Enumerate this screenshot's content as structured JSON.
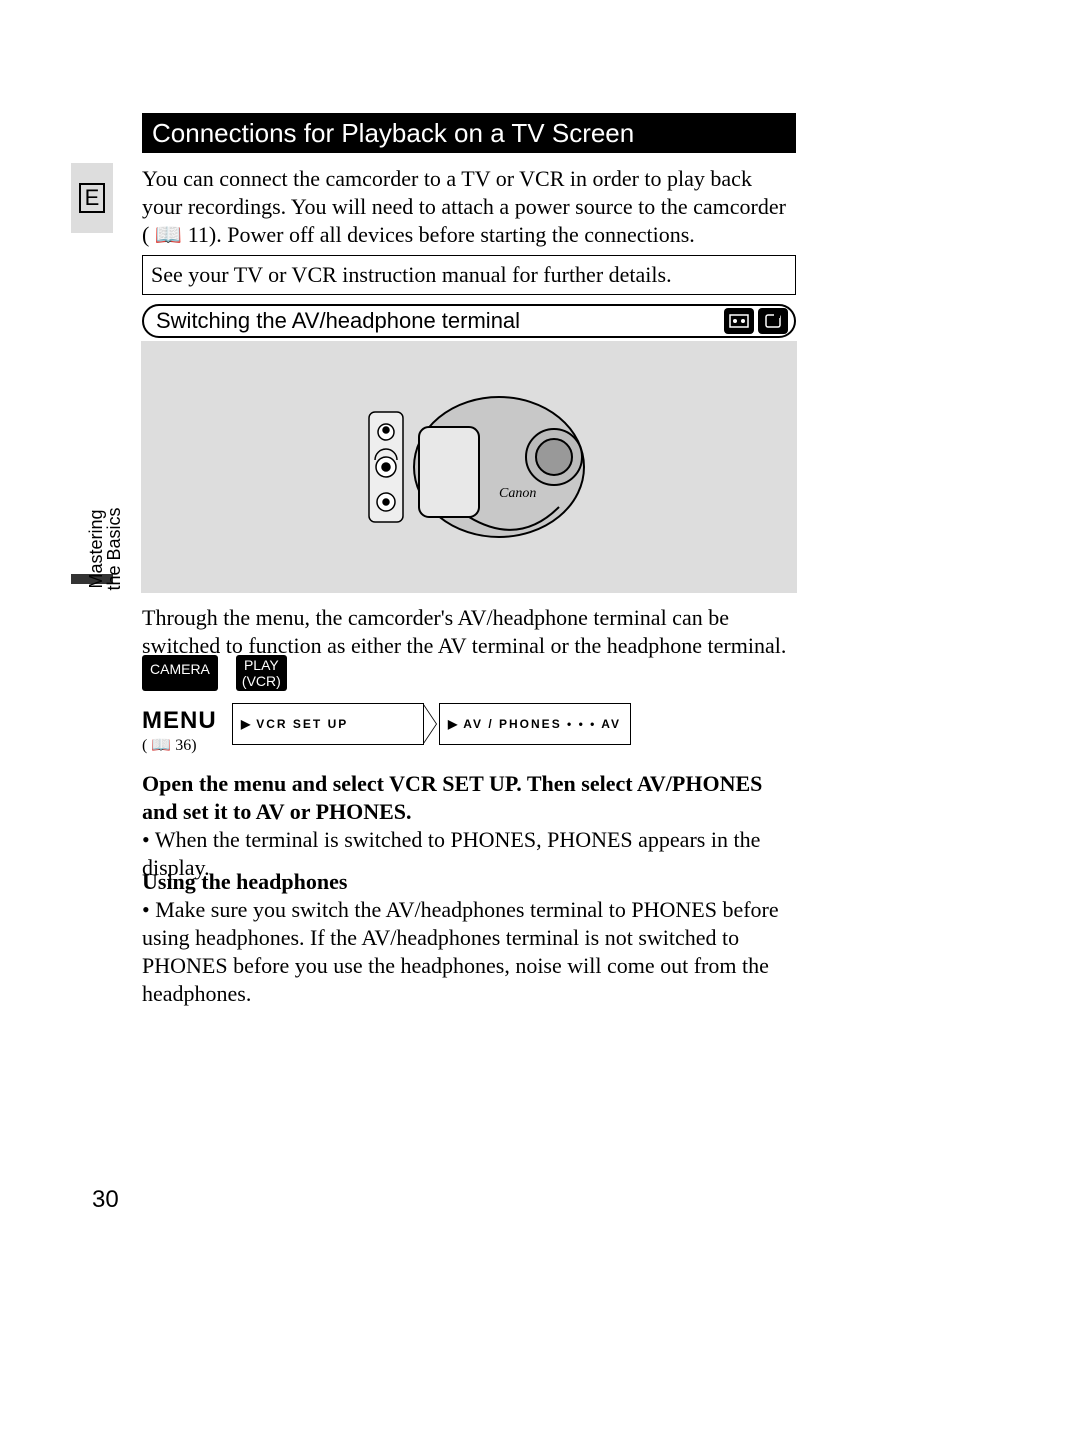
{
  "page_number": "30",
  "side_tab": {
    "line1": "Mastering",
    "line2": "the Basics"
  },
  "title": "Connections for Playback on a TV Screen",
  "language_badge": "E",
  "intro": "You can connect the camcorder to a TV or VCR in order to play back your recordings. You will need to attach a power source to the camcorder ( 📖 11). Power off all devices before starting the connections.",
  "note_box": "See your TV or VCR instruction manual for further details.",
  "sub_heading": "Switching the AV/headphone terminal",
  "body_after_illus": "Through the menu, the camcorder's AV/headphone terminal can be switched to function as either the AV terminal or the headphone terminal.",
  "mode_badges": {
    "camera": "CAMERA",
    "play_l1": "PLAY",
    "play_l2": "(VCR)"
  },
  "menu_label": "MENU",
  "menu_ref": "( 📖 36)",
  "menu_path": {
    "step1": "VCR SET UP",
    "step2": "AV / PHONES • • • AV"
  },
  "instruction_bold": "Open the menu and select VCR SET UP. Then select AV/PHONES and set it to AV or PHONES.",
  "instruction_bullet": "When the terminal is switched to PHONES, PHONES appears in the display.",
  "headphones_heading": "Using the headphones",
  "headphones_bullet": "Make sure you switch the AV/headphones terminal to PHONES before using headphones. If the AV/headphones terminal is not switched to PHONES before you use the headphones, noise will come out from the headphones."
}
